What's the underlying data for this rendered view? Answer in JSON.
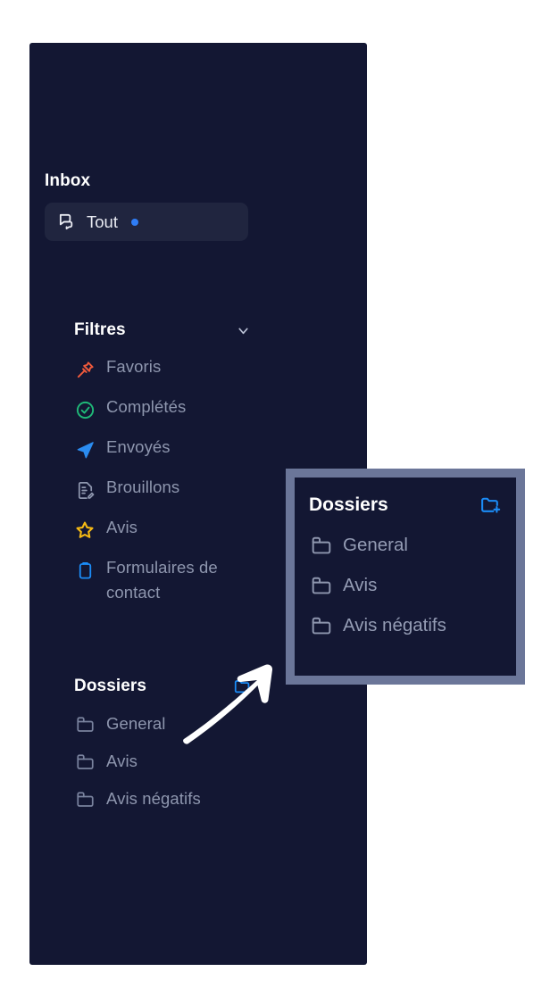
{
  "theme": {
    "panel_bg": "#131733",
    "page_bg": "#ffffff",
    "active_pill_bg": "#20253f",
    "heading_color": "#ffffff",
    "muted_text": "#8e96ae",
    "accent_blue": "#1b8cf7",
    "dot_blue": "#2f7df6",
    "callout_border": "#6b7699",
    "icon_favoris": "#ef5a3c",
    "icon_completes": "#1fb978",
    "icon_envoyes": "#2b8cf0",
    "icon_brouillons": "#8e96ae",
    "icon_avis": "#f5b914",
    "icon_formulaires": "#1b8cf7",
    "icon_folder": "#7a839e"
  },
  "sidebar": {
    "inbox": {
      "heading": "Inbox",
      "items": [
        {
          "label": "Tout",
          "icon": "chat-bubbles-icon",
          "active": true,
          "has_dot": true
        }
      ]
    },
    "filtres": {
      "heading": "Filtres",
      "chevron_icon": "chevron-down-icon",
      "items": [
        {
          "label": "Favoris",
          "icon": "pin-icon"
        },
        {
          "label": "Complétés",
          "icon": "check-circle-icon"
        },
        {
          "label": "Envoyés",
          "icon": "paper-plane-icon"
        },
        {
          "label": "Brouillons",
          "icon": "draft-document-icon"
        },
        {
          "label": "Avis",
          "icon": "star-icon"
        },
        {
          "label": "Formulaires de contact",
          "icon": "clipboard-icon"
        }
      ]
    },
    "dossiers": {
      "heading": "Dossiers",
      "add_icon": "folder-plus-icon",
      "items": [
        {
          "label": "General",
          "icon": "folder-icon"
        },
        {
          "label": "Avis",
          "icon": "folder-icon"
        },
        {
          "label": "Avis négatifs",
          "icon": "folder-icon"
        }
      ]
    }
  },
  "callout": {
    "heading": "Dossiers",
    "add_icon": "folder-plus-icon",
    "items": [
      {
        "label": "General",
        "icon": "folder-icon"
      },
      {
        "label": "Avis",
        "icon": "folder-icon"
      },
      {
        "label": "Avis négatifs",
        "icon": "folder-icon"
      }
    ]
  },
  "annotation": {
    "arrow_icon": "arrow-up-right-icon"
  }
}
